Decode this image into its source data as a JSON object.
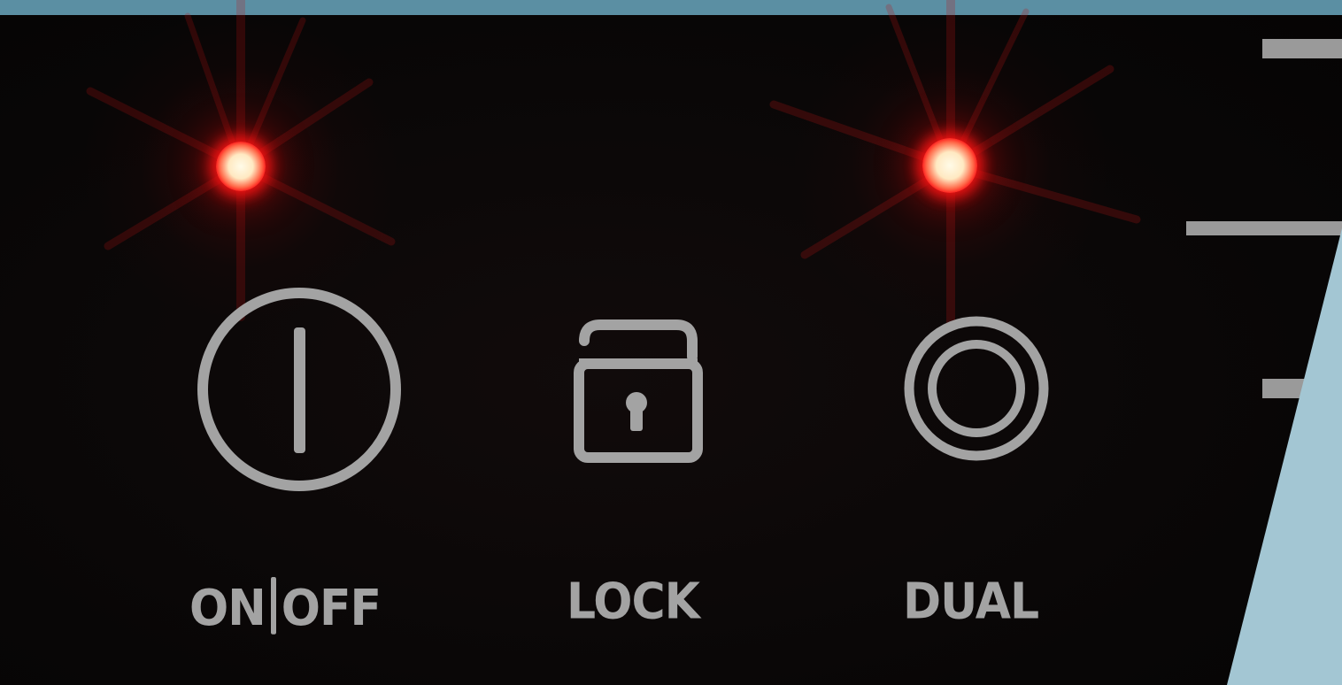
{
  "controls": {
    "power": {
      "label_on": "ON",
      "label_off": "OFF",
      "icon": "power-icon",
      "indicator_lit": true
    },
    "lock": {
      "label": "LOCK",
      "icon": "lock-icon",
      "indicator_lit": false
    },
    "dual": {
      "label": "DUAL",
      "icon": "dual-ring-icon",
      "indicator_lit": true
    }
  },
  "colors": {
    "panel": "#080606",
    "icon_gray": "#a3a3a3",
    "led_red": "#ff1a1a",
    "strip_blue": "#5b8fa3",
    "wedge_blue": "#a3c6d3"
  }
}
